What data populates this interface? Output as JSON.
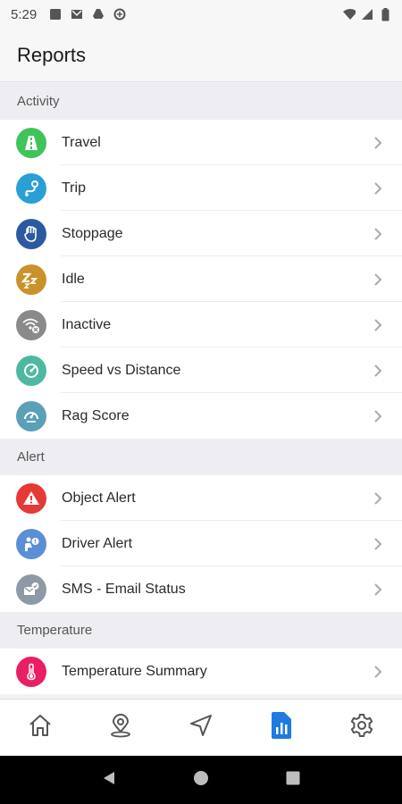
{
  "status_bar": {
    "time": "5:29"
  },
  "header": {
    "title": "Reports"
  },
  "sections": [
    {
      "title": "Activity",
      "items": [
        {
          "label": "Travel",
          "icon": "road-icon",
          "color": "#3ec45a"
        },
        {
          "label": "Trip",
          "icon": "route-icon",
          "color": "#2a9fd6"
        },
        {
          "label": "Stoppage",
          "icon": "hand-icon",
          "color": "#2c5aa0"
        },
        {
          "label": "Idle",
          "icon": "sleep-icon",
          "color": "#c9922a"
        },
        {
          "label": "Inactive",
          "icon": "no-signal-icon",
          "color": "#8a8a8a"
        },
        {
          "label": "Speed vs Distance",
          "icon": "speed-distance-icon",
          "color": "#4fb8a0"
        },
        {
          "label": "Rag Score",
          "icon": "rag-score-icon",
          "color": "#5aa0b8"
        }
      ]
    },
    {
      "title": "Alert",
      "items": [
        {
          "label": "Object Alert",
          "icon": "warning-icon",
          "color": "#e53935"
        },
        {
          "label": "Driver Alert",
          "icon": "driver-alert-icon",
          "color": "#5a8fd6"
        },
        {
          "label": "SMS - Email Status",
          "icon": "sms-email-icon",
          "color": "#8e99a6"
        }
      ]
    },
    {
      "title": "Temperature",
      "items": [
        {
          "label": "Temperature Summary",
          "icon": "thermometer-icon",
          "color": "#e91e63"
        }
      ]
    }
  ],
  "bottom_nav": [
    {
      "name": "home",
      "icon": "home-icon",
      "active": false
    },
    {
      "name": "location",
      "icon": "location-pin-icon",
      "active": false
    },
    {
      "name": "navigate",
      "icon": "navigation-arrow-icon",
      "active": false
    },
    {
      "name": "reports",
      "icon": "reports-icon",
      "active": true
    },
    {
      "name": "settings",
      "icon": "gear-icon",
      "active": false
    }
  ],
  "colors": {
    "accent": "#1e7be0",
    "nav_inactive": "#555555"
  }
}
